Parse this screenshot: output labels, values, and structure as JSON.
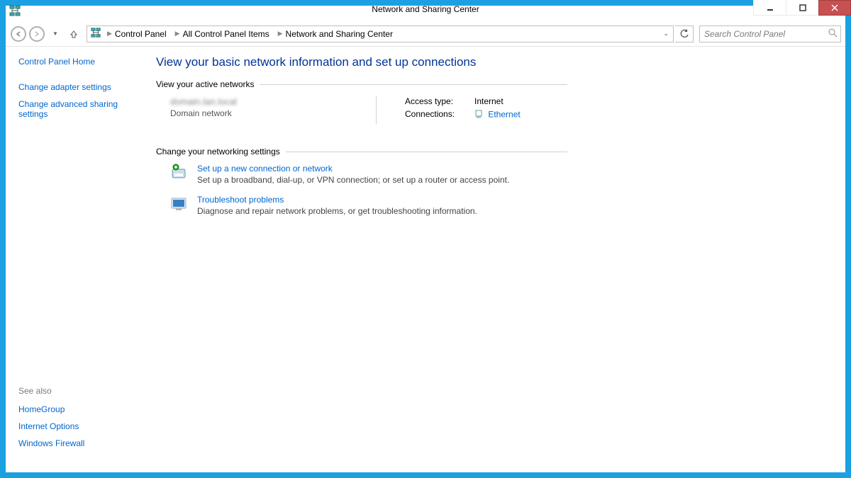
{
  "window": {
    "title": "Network and Sharing Center"
  },
  "breadcrumb": {
    "items": [
      "Control Panel",
      "All Control Panel Items",
      "Network and Sharing Center"
    ]
  },
  "search": {
    "placeholder": "Search Control Panel"
  },
  "sidebar": {
    "home": "Control Panel Home",
    "links": {
      "adapter": "Change adapter settings",
      "advanced": "Change advanced sharing settings"
    }
  },
  "seealso": {
    "title": "See also",
    "items": {
      "homegroup": "HomeGroup",
      "internet_options": "Internet Options",
      "firewall": "Windows Firewall"
    }
  },
  "main": {
    "heading": "View your basic network information and set up connections",
    "active_section": "View your active networks",
    "network": {
      "name": "domain.lan.local",
      "type": "Domain network",
      "access_label": "Access type:",
      "access_value": "Internet",
      "conn_label": "Connections:",
      "conn_value": "Ethernet"
    },
    "change_section": "Change your networking settings",
    "setup": {
      "title": "Set up a new connection or network",
      "desc": "Set up a broadband, dial-up, or VPN connection; or set up a router or access point."
    },
    "trouble": {
      "title": "Troubleshoot problems",
      "desc": "Diagnose and repair network problems, or get troubleshooting information."
    }
  }
}
